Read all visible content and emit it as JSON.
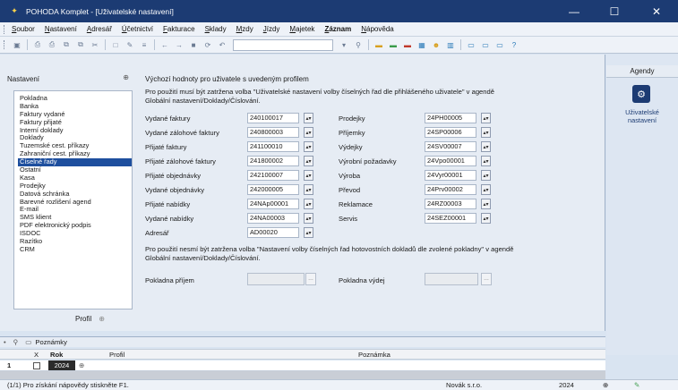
{
  "window": {
    "title": "POHODA Komplet - [Uživatelské nastavení]",
    "minimize": "—",
    "maximize": "☐",
    "close": "✕"
  },
  "menu": [
    "Soubor",
    "Nastavení",
    "Adresář",
    "Účetnictví",
    "Fakturace",
    "Sklady",
    "Mzdy",
    "Jízdy",
    "Majetek",
    "Záznam",
    "Nápověda"
  ],
  "left_panel": {
    "title": "Nastavení",
    "items": [
      "Pokladna",
      "Banka",
      "Faktury vydané",
      "Faktury přijaté",
      "Interní doklady",
      "Doklady",
      "Tuzemské cest. příkazy",
      "Zahraniční cest. příkazy",
      "Číselné řady",
      "Ostatní",
      "Kasa",
      "Prodejky",
      "Datová schránka",
      "Barevné rozlišení agend",
      "E-mail",
      "SMS klient",
      "PDF elektronický podpis",
      "ISDOC",
      "Razítko",
      "CRM"
    ],
    "selected": "Číselné řady",
    "profile_label": "Profil"
  },
  "content": {
    "header": "Výchozí hodnoty pro uživatele s uvedeným profilem",
    "note1": "Pro použití musí být zatržena volba \"Uživatelské nastavení volby číselných řad dle přihlášeného uživatele\" v agendě Globální nastavení/Doklady/Číslování.",
    "left_rows": [
      {
        "label": "Vydané faktury",
        "value": "240100017"
      },
      {
        "label": "Vydané zálohové faktury",
        "value": "240800003"
      },
      {
        "label": "Přijaté faktury",
        "value": "241100010"
      },
      {
        "label": "Přijaté zálohové faktury",
        "value": "241800002"
      },
      {
        "label": "Přijaté objednávky",
        "value": "242100007"
      },
      {
        "label": "Vydané objednávky",
        "value": "242000005"
      },
      {
        "label": "Přijaté nabídky",
        "value": "24NAp00001"
      },
      {
        "label": "Vydané nabídky",
        "value": "24NA00003"
      },
      {
        "label": "Adresář",
        "value": "AD00020"
      }
    ],
    "right_rows": [
      {
        "label": "Prodejky",
        "value": "24PH00005"
      },
      {
        "label": "Příjemky",
        "value": "24SP00006"
      },
      {
        "label": "Výdejky",
        "value": "24SV00007"
      },
      {
        "label": "Výrobní požadavky",
        "value": "24Vpo00001"
      },
      {
        "label": "Výroba",
        "value": "24Vyr00001"
      },
      {
        "label": "Převod",
        "value": "24Prv00002"
      },
      {
        "label": "Reklamace",
        "value": "24RZ00003"
      },
      {
        "label": "Servis",
        "value": "24SEZ00001"
      }
    ],
    "note2": "Pro použití nesmí být zatržena volba \"Nastavení volby číselných řad hotovostních dokladů dle zvolené pokladny\" v agendě Globální nastavení/Doklady/Číslování.",
    "pokladna_prijem_label": "Pokladna příjem",
    "pokladna_vydej_label": "Pokladna výdej"
  },
  "agendy": {
    "title": "Agendy",
    "item_label": "Uživatelské nastavení"
  },
  "bottom": {
    "tab_label": "Poznámky",
    "col_x": "X",
    "col_rok": "Rok",
    "col_profil": "Profil",
    "col_poznamka": "Poznámka",
    "row_num": "1",
    "row_year": "2024"
  },
  "status": {
    "help": "(1/1) Pro získání nápovědy stiskněte F1.",
    "user": "Novák s.r.o.",
    "year": "2024"
  },
  "icons": [
    "app-icon",
    "pin-icon",
    "settings-icon",
    "filter-icon",
    "note-icon",
    "checkbox-icon",
    "pen-icon"
  ]
}
